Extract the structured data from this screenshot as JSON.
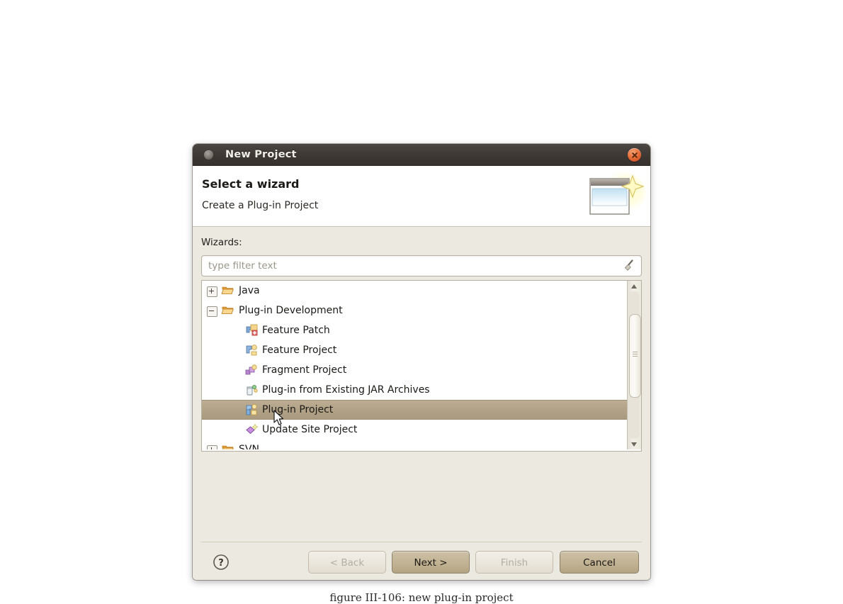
{
  "window": {
    "title": "New Project",
    "title_icon": "app-dot-icon",
    "close_icon": "close-icon"
  },
  "header": {
    "title": "Select a wizard",
    "subtitle": "Create a Plug-in Project",
    "banner_icon": "new-project-wizard-banner-icon"
  },
  "body": {
    "wizards_label": "Wizards:",
    "filter": {
      "value": "",
      "placeholder": "type filter text",
      "clear_icon": "clear-filter-broom-icon"
    },
    "tree": [
      {
        "label": "Java",
        "level": 0,
        "expander": "plus",
        "icon": "folder-icon",
        "selected": false
      },
      {
        "label": "Plug-in Development",
        "level": 0,
        "expander": "minus",
        "icon": "folder-icon",
        "selected": false
      },
      {
        "label": "Feature Patch",
        "level": 1,
        "expander": "none",
        "icon": "feature-patch-icon",
        "selected": false
      },
      {
        "label": "Feature Project",
        "level": 1,
        "expander": "none",
        "icon": "feature-project-icon",
        "selected": false
      },
      {
        "label": "Fragment Project",
        "level": 1,
        "expander": "none",
        "icon": "fragment-project-icon",
        "selected": false
      },
      {
        "label": "Plug-in from Existing JAR Archives",
        "level": 1,
        "expander": "none",
        "icon": "jar-plugin-icon",
        "selected": false
      },
      {
        "label": "Plug-in Project",
        "level": 1,
        "expander": "none",
        "icon": "plugin-project-icon",
        "selected": true
      },
      {
        "label": "Update Site Project",
        "level": 1,
        "expander": "none",
        "icon": "update-site-icon",
        "selected": false
      },
      {
        "label": "SVN",
        "level": 0,
        "expander": "plus",
        "icon": "folder-icon",
        "selected": false
      }
    ],
    "scrollbar": {
      "up_icon": "scroll-up-arrow-icon",
      "down_icon": "scroll-down-arrow-icon",
      "thumb": "scroll-thumb"
    }
  },
  "buttons": {
    "help_icon": "help-question-icon",
    "back": "< Back",
    "next": "Next >",
    "finish": "Finish",
    "cancel": "Cancel"
  },
  "caption": "figure III-106:  new plug-in project",
  "colors": {
    "titlebar": "#3d3834",
    "close": "#e8703a",
    "dialog_body": "#ece9e1",
    "selection": "#b2a287",
    "default_button": "#c2b394",
    "list_background": "#ffffff"
  }
}
